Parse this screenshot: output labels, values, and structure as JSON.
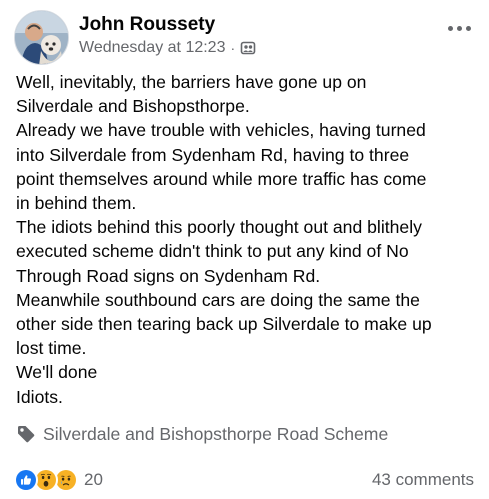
{
  "post": {
    "author": "John Roussety",
    "timestamp": "Wednesday at 12:23",
    "separator": "·",
    "audience_icon": "group-audience-icon",
    "more_icon": "more-options-icon",
    "body_lines": [
      "Well, inevitably, the barriers have gone up on",
      "Silverdale and Bishopsthorpe.",
      "Already we have trouble with vehicles, having turned",
      "into Silverdale from Sydenham Rd, having to three",
      "point themselves around while more traffic has come",
      "in behind them.",
      "The idiots behind this poorly thought out and blithely",
      "executed scheme didn't think to put any kind of No",
      "Through Road signs on Sydenham Rd.",
      "Meanwhile southbound cars are doing the same the",
      "other side then tearing back up Silverdale to make up",
      "lost time.",
      "We'll done",
      "Idiots."
    ],
    "topic": {
      "icon": "tag-icon",
      "label": "Silverdale and Bishopsthorpe Road Scheme"
    },
    "reactions": {
      "icons": [
        "like-reaction-icon",
        "wow-reaction-icon",
        "sad-reaction-icon"
      ],
      "count": "20"
    },
    "comments": "43 comments"
  },
  "colors": {
    "text": "#050505",
    "secondary_text": "#65676b",
    "like_blue": "#1877f2",
    "reaction_yellow": "#f7b125"
  }
}
